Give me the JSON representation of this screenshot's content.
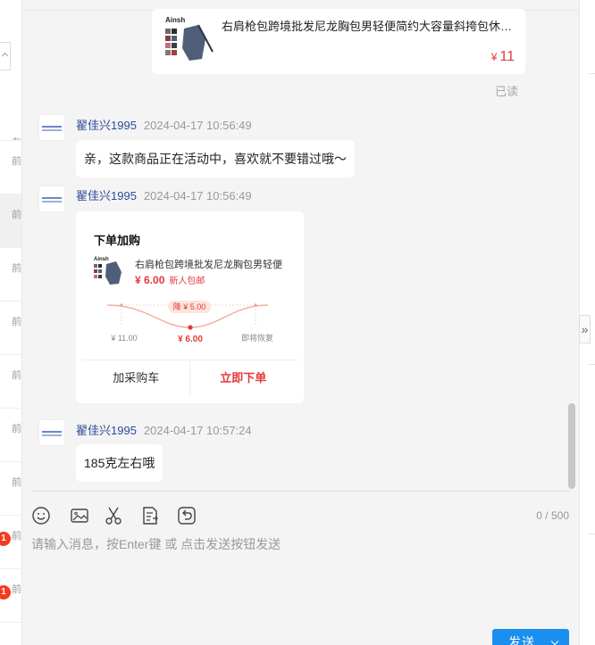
{
  "conversation_list": {
    "items": [
      {
        "time": "在",
        "unread": ""
      },
      {
        "time": "前",
        "unread": ""
      },
      {
        "time": "前",
        "unread": ""
      },
      {
        "time": "前",
        "unread": ""
      },
      {
        "time": "前",
        "unread": ""
      },
      {
        "time": "前",
        "unread": ""
      },
      {
        "time": "前",
        "unread": ""
      },
      {
        "time": "前",
        "unread": ""
      },
      {
        "time": "前",
        "unread": "1"
      },
      {
        "time": "前",
        "unread": "1"
      }
    ]
  },
  "chat": {
    "product_card": {
      "title": "右肩枪包跨境批发尼龙胸包男轻便简约大容量斜挎包休…",
      "currency": "¥",
      "price": "11",
      "thumb_brand": "Ainsh",
      "read_status": "已读"
    },
    "messages": [
      {
        "sender": "翟佳兴1995",
        "timestamp": "2024-04-17 10:56:49",
        "text": "亲，这款商品正在活动中，喜欢就不要错过哦～"
      },
      {
        "sender": "翟佳兴1995",
        "timestamp": "2024-04-17 10:56:49"
      },
      {
        "sender": "翟佳兴1995",
        "timestamp": "2024-04-17 10:57:24",
        "text": "185克左右哦"
      }
    ],
    "order_card": {
      "heading": "下单加购",
      "product_name": "右肩枪包跨境批发尼龙胸包男轻便",
      "price": "¥ 6.00",
      "tag": "新人包邮",
      "discount_badge": "降 ¥ 5.00",
      "price_original": "¥ 11.00",
      "price_now": "¥ 6.00",
      "price_restore": "即将恢复",
      "add_cart_label": "加采购车",
      "buy_now_label": "立即下单"
    }
  },
  "composer": {
    "tools": [
      {
        "icon": "emoji-icon"
      },
      {
        "icon": "image-icon"
      },
      {
        "icon": "scissors-icon"
      },
      {
        "icon": "quick-reply-icon"
      },
      {
        "icon": "undo-icon"
      }
    ],
    "char_count": "0 / 500",
    "placeholder": "请输入消息，按Enter键 或 点击发送按钮发送",
    "send_label": "发送"
  },
  "colors": {
    "accent_red": "#e4393c",
    "send_blue": "#1b8ff0",
    "name_blue": "#2c4a9a",
    "badge_red": "#f53b1d"
  }
}
